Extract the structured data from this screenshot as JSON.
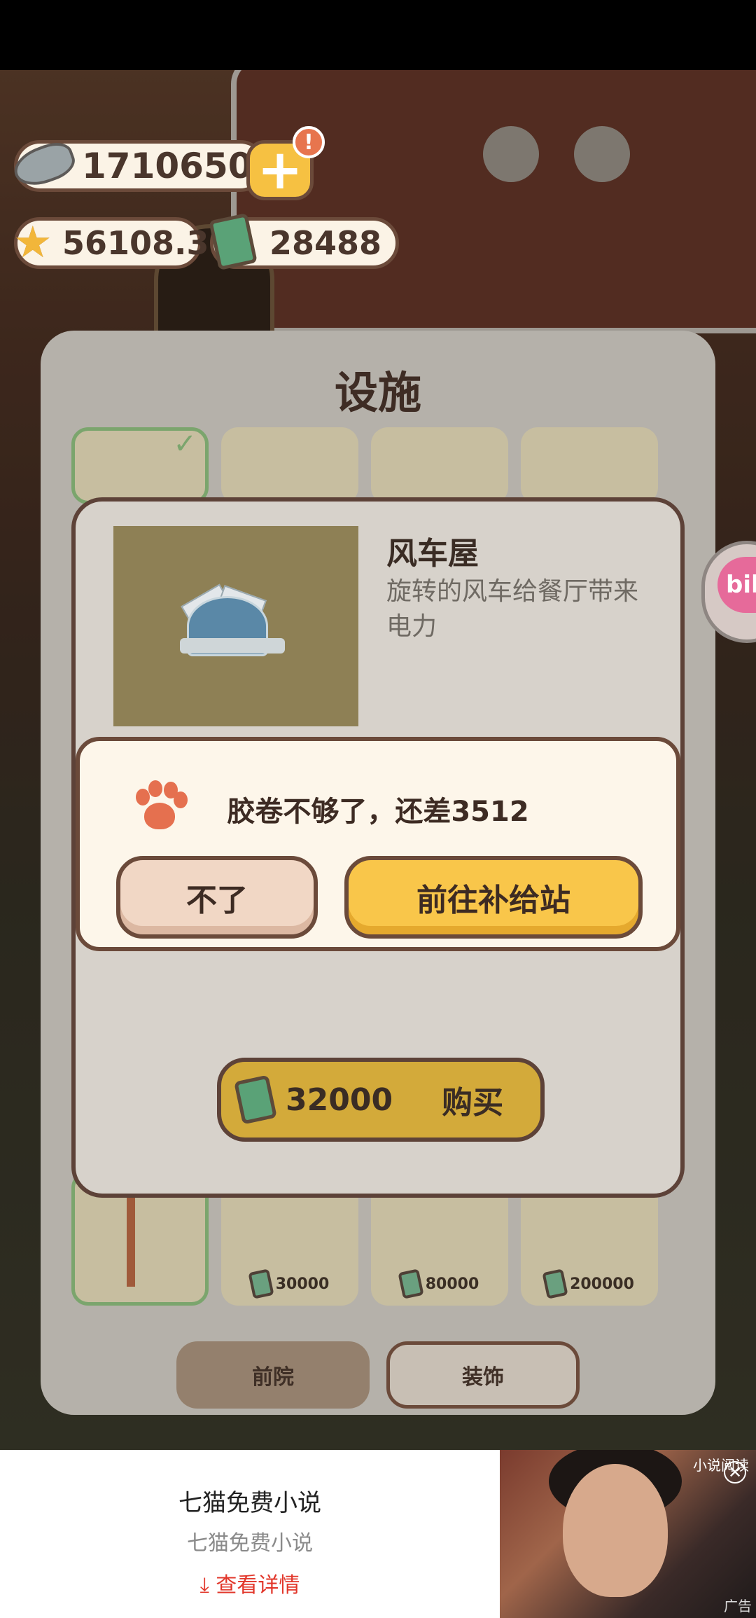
{
  "hud": {
    "fish_count": "17106505",
    "plus_label": "+",
    "alert_label": "!",
    "star_score": "56108.3",
    "film_count": "28488"
  },
  "panel": {
    "title": "设施",
    "cards_bottom": [
      {
        "price": ""
      },
      {
        "price": "30000"
      },
      {
        "price": "80000"
      },
      {
        "price": "200000"
      }
    ],
    "tabs": [
      {
        "label": "前院"
      },
      {
        "label": "装饰"
      }
    ]
  },
  "detail": {
    "name": "风车屋",
    "description": "旋转的风车给餐厅带来电力",
    "buy_price": "32000",
    "buy_label": "购买"
  },
  "dialog": {
    "message": "胶卷不够了，还差3512",
    "cancel_label": "不了",
    "confirm_label": "前往补给站"
  },
  "side_bubble": {
    "text": "bili"
  },
  "ad": {
    "title": "七猫免费小说",
    "subtitle": "七猫免费小说",
    "link": "查看详情",
    "link_icon": "download-arrow-icon",
    "tag": "小说阅读",
    "close": "✕",
    "mark": "广告"
  },
  "colors": {
    "accent_yellow": "#f9c64a",
    "outline_brown": "#6b4a3a",
    "paw_orange": "#e5704f",
    "ad_link_red": "#e2372b"
  }
}
